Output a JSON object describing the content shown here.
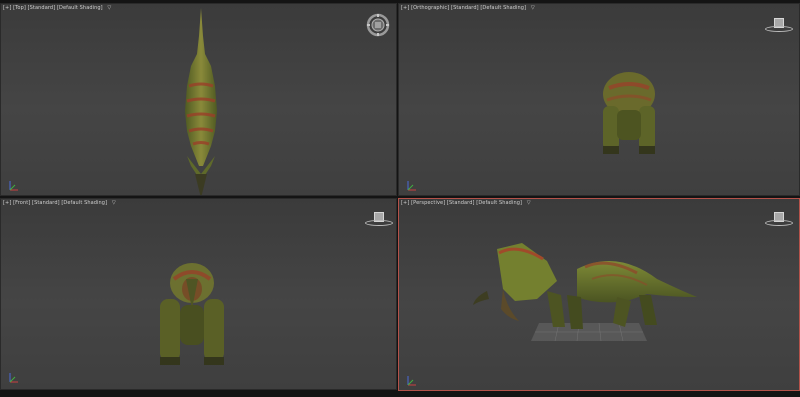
{
  "viewports": {
    "top": {
      "label": "[+] [Top] [Standard] [Default Shading]"
    },
    "ortho": {
      "label": "[+] [Orthographic] [Standard] [Default Shading]"
    },
    "front": {
      "label": "[+] [Front] [Standard] [Default Shading]"
    },
    "persp": {
      "label": "[+] [Perspective] [Standard] [Default Shading]"
    }
  },
  "filter_glyph": "▽",
  "icons": {
    "view_cube": "view-cube-icon",
    "nav_wheel": "steering-wheel-icon",
    "axis_tripod": "axis-tripod-icon"
  },
  "colors": {
    "viewport_bg": "#404040",
    "active_border": "#b5524a",
    "model_green": "#6b7a2f",
    "model_red": "#8a4a2c"
  }
}
